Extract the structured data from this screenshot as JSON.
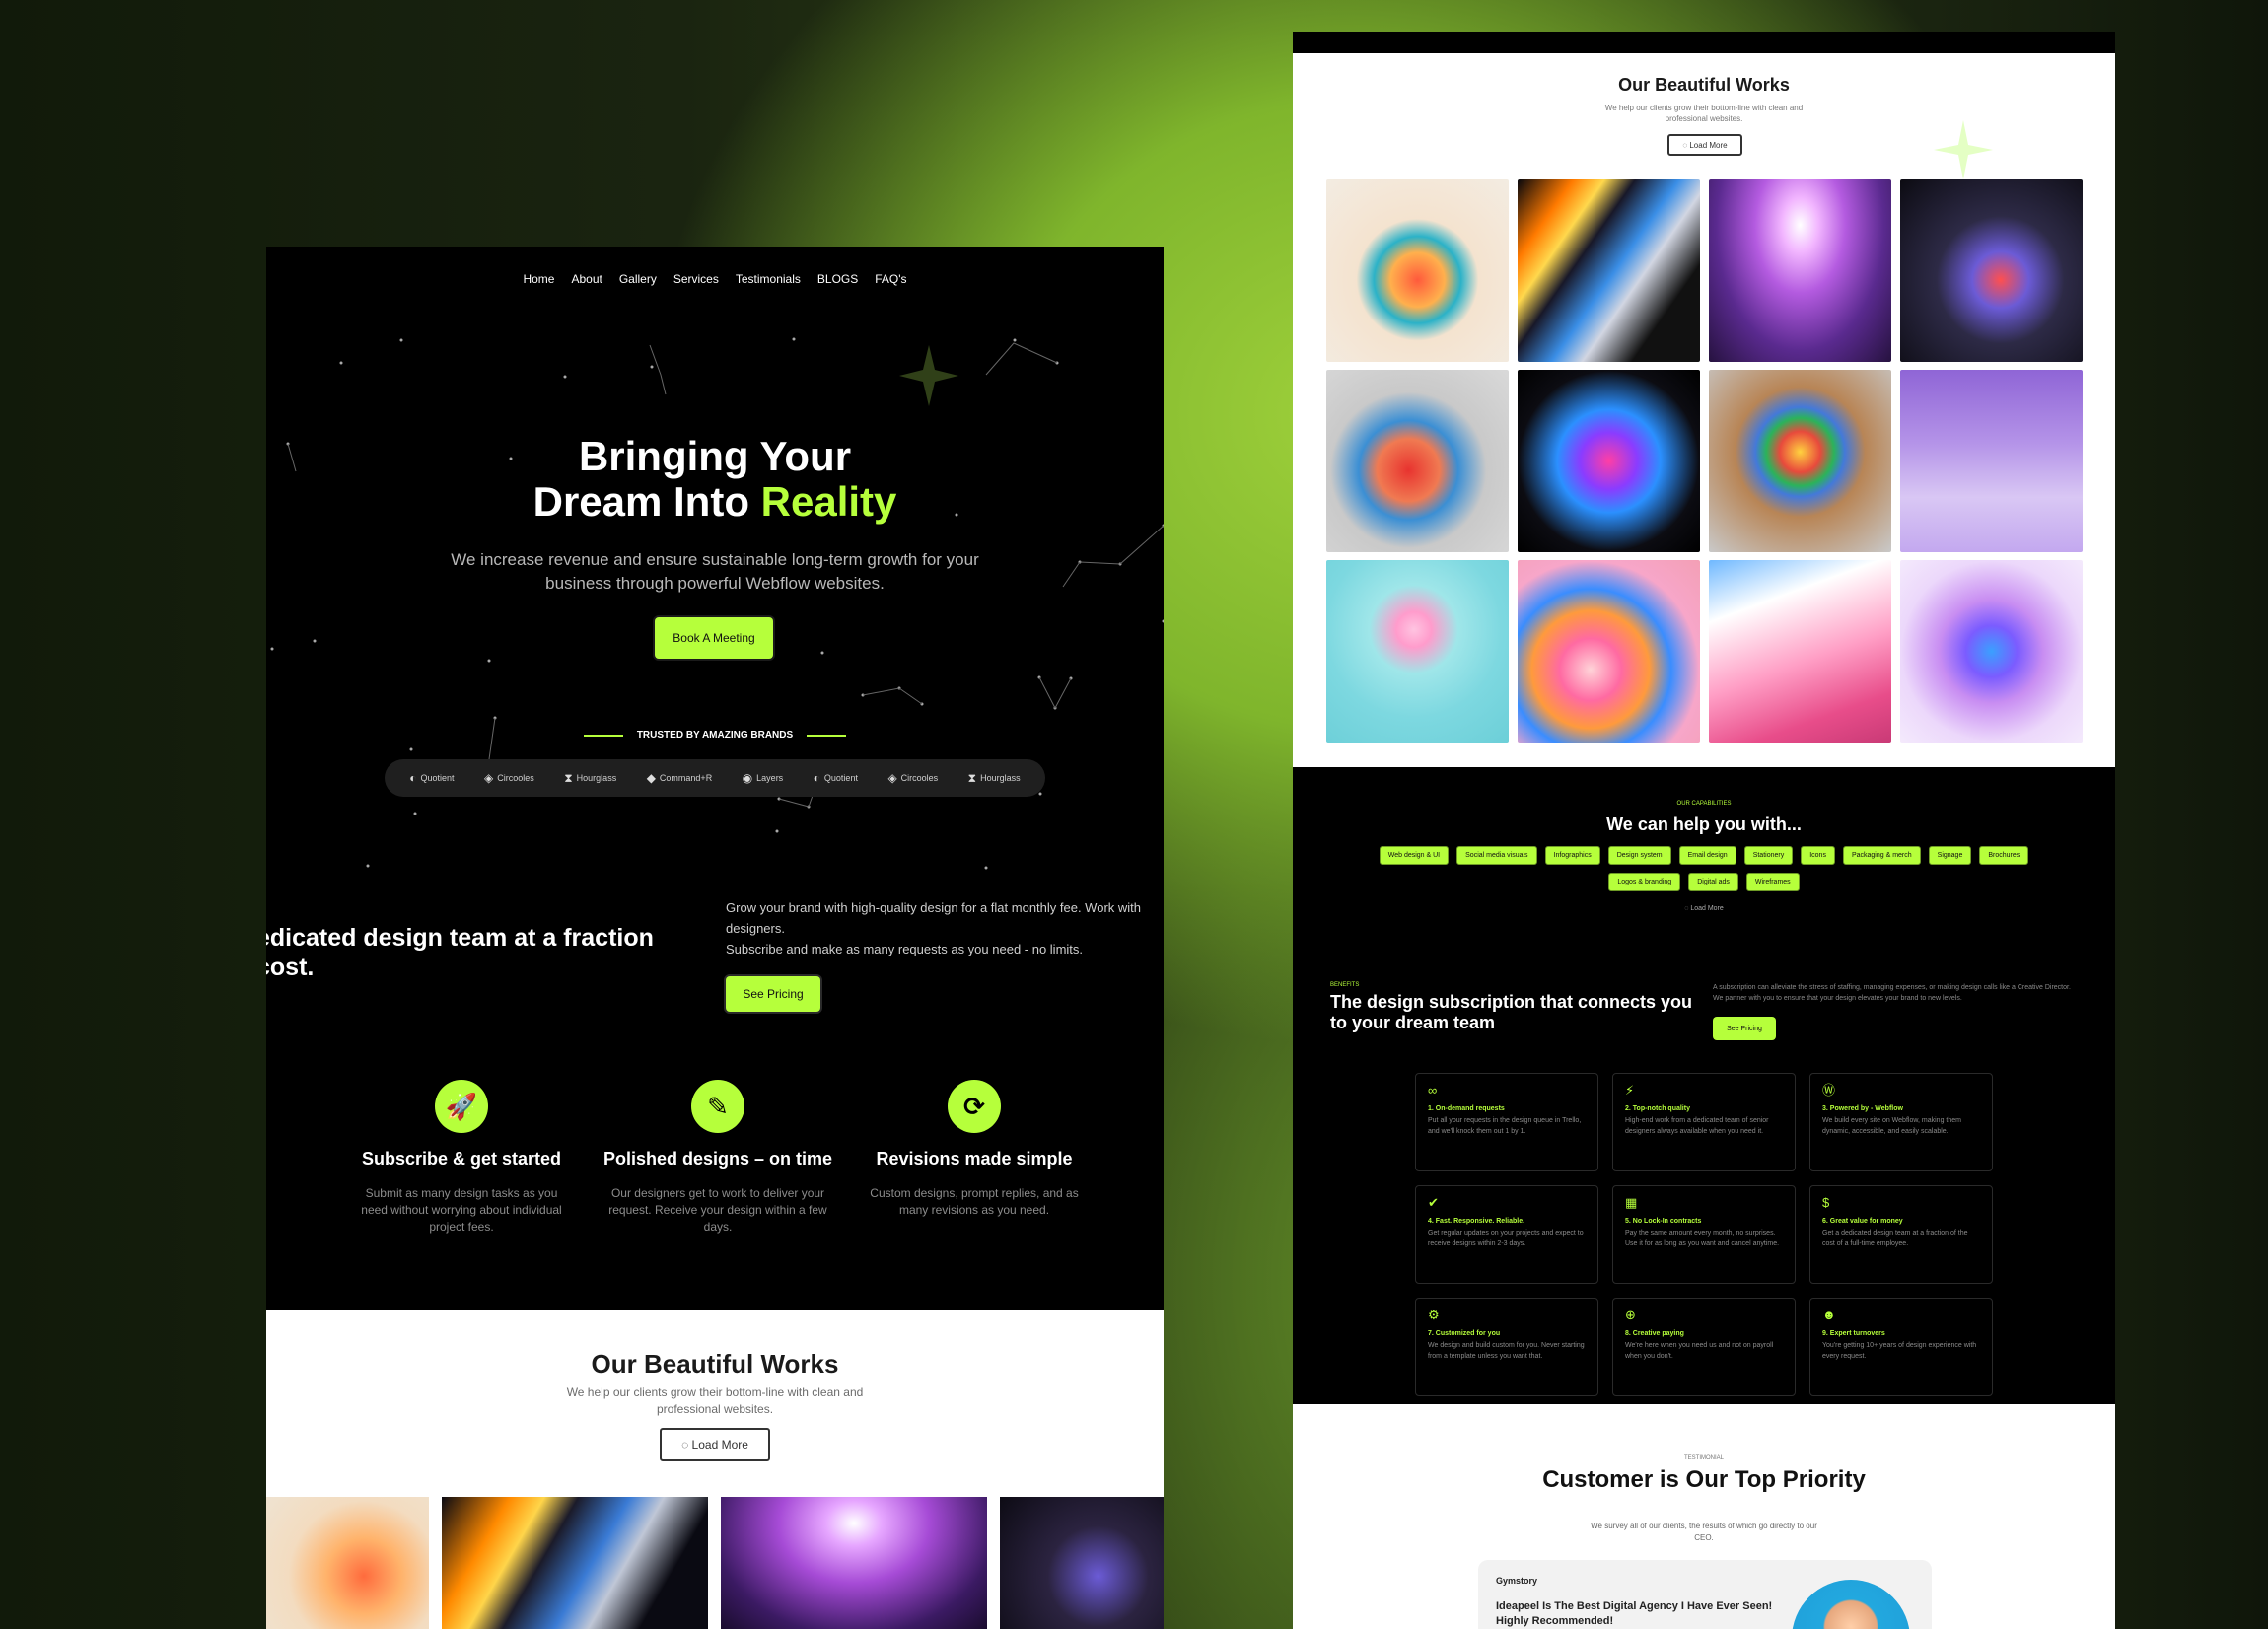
{
  "colors": {
    "accent": "#b6ff3b",
    "dark": "#000000",
    "light": "#ffffff"
  },
  "left": {
    "nav": [
      "Home",
      "About",
      "Gallery",
      "Services",
      "Testimonials",
      "BLOGS",
      "FAQ's"
    ],
    "hero": {
      "title_line1": "Bringing Your",
      "title_line2_plain": "Dream Into ",
      "title_line2_accent": "Reality",
      "subtitle": "We increase revenue and ensure sustainable long-term growth for your business through powerful Webflow websites.",
      "cta": "Book A Meeting"
    },
    "trusted_label": "TRUSTED BY AMAZING BRANDS",
    "brands": [
      {
        "icon": "quotient-logo-icon",
        "name": "Quotient"
      },
      {
        "icon": "circooles-logo-icon",
        "name": "Circooles"
      },
      {
        "icon": "hourglass-logo-icon",
        "name": "Hourglass"
      },
      {
        "icon": "command-r-logo-icon",
        "name": "Command+R"
      },
      {
        "icon": "layers-logo-icon",
        "name": "Layers"
      },
      {
        "icon": "quotient-logo-icon",
        "name": "Quotient"
      },
      {
        "icon": "circooles-logo-icon",
        "name": "Circooles"
      },
      {
        "icon": "hourglass-logo-icon",
        "name": "Hourglass"
      }
    ],
    "dedicated": "edicated design team at a fraction cost.",
    "grow_line1": "Grow your brand with high-quality design for a flat monthly fee. Work with designers.",
    "grow_line2": "Subscribe and make as many requests as you need - no limits.",
    "see_pricing": "See Pricing",
    "features": [
      {
        "icon": "rocket-icon",
        "title": "Subscribe & get started",
        "text": "Submit as many design tasks as you need without worrying about individual project fees."
      },
      {
        "icon": "design-icon",
        "title": "Polished designs – on time",
        "text": "Our designers get to work to deliver your request. Receive your design within a few days."
      },
      {
        "icon": "refresh-icon",
        "title": "Revisions made simple",
        "text": "Custom designs, prompt replies, and as many revisions as you need."
      }
    ],
    "works": {
      "title": "Our Beautiful Works",
      "subtitle": "We help our clients grow their bottom-line with clean and professional websites.",
      "load_more": "Load More"
    }
  },
  "right": {
    "works": {
      "title": "Our Beautiful Works",
      "subtitle": "We help our clients grow their bottom-line with clean and professional websites.",
      "load_more": "Load More"
    },
    "capabilities": {
      "tag": "OUR CAPABILITIES",
      "title": "We can help you with...",
      "chips": [
        "Web design & UI",
        "Social media visuals",
        "Infographics",
        "Design system",
        "Email design",
        "Stationery",
        "Icons",
        "Packaging & merch",
        "Signage",
        "Brochures",
        "Logos & branding",
        "Digital ads",
        "Wireframes"
      ],
      "load_more": "Load More"
    },
    "benefits": {
      "tag": "BENEFITS",
      "title": "The design subscription that connects you to your dream team",
      "text": "A subscription can alleviate the stress of staffing, managing expenses, or making design calls like a Creative Director. We partner with you to ensure that your design elevates your brand to new levels.",
      "see_pricing": "See Pricing",
      "cards": [
        {
          "icon": "infinity-icon",
          "title": "1. On-demand requests",
          "text": "Put all your requests in the design queue in Trello, and we'll knock them out 1 by 1."
        },
        {
          "icon": "lightning-icon",
          "title": "2. Top-notch quality",
          "text": "High-end work from a dedicated team of senior designers always available when you need it."
        },
        {
          "icon": "webflow-icon",
          "title": "3. Powered by - Webflow",
          "text": "We build every site on Webflow, making them dynamic, accessible, and easily scalable."
        },
        {
          "icon": "check-brush-icon",
          "title": "4. Fast. Responsive. Reliable.",
          "text": "Get regular updates on your projects and expect to receive designs within 2-3 days."
        },
        {
          "icon": "calendar-icon",
          "title": "5. No Lock-In contracts",
          "text": "Pay the same amount every month, no surprises. Use it for as long as you want and cancel anytime."
        },
        {
          "icon": "money-icon",
          "title": "6. Great value for money",
          "text": "Get a dedicated design team at a fraction of the cost of a full-time employee."
        },
        {
          "icon": "gear-icon",
          "title": "7. Customized for you",
          "text": "We design and build custom for you. Never starting from a template unless you want that."
        },
        {
          "icon": "search-money-icon",
          "title": "8. Creative paying",
          "text": "We're here when you need us and not on payroll when you don't."
        },
        {
          "icon": "team-icon",
          "title": "9. Expert turnovers",
          "text": "You're getting 10+ years of design experience with every request."
        }
      ]
    },
    "testimonial": {
      "tag": "TESTIMONIAL",
      "title": "Customer is Our Top Priority",
      "subtitle": "We survey all of our clients, the results of which go directly to our CEO.",
      "company": "Gymstory",
      "quote": "Ideapeel Is The Best Digital Agency I Have Ever Seen! Highly Recommended!"
    }
  }
}
